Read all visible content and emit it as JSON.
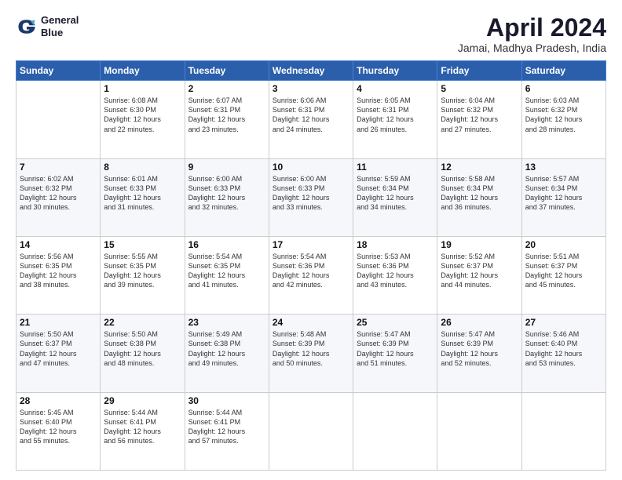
{
  "logo": {
    "line1": "General",
    "line2": "Blue"
  },
  "title": "April 2024",
  "subtitle": "Jamai, Madhya Pradesh, India",
  "days_of_week": [
    "Sunday",
    "Monday",
    "Tuesday",
    "Wednesday",
    "Thursday",
    "Friday",
    "Saturday"
  ],
  "weeks": [
    [
      {
        "day": "",
        "info": ""
      },
      {
        "day": "1",
        "info": "Sunrise: 6:08 AM\nSunset: 6:30 PM\nDaylight: 12 hours\nand 22 minutes."
      },
      {
        "day": "2",
        "info": "Sunrise: 6:07 AM\nSunset: 6:31 PM\nDaylight: 12 hours\nand 23 minutes."
      },
      {
        "day": "3",
        "info": "Sunrise: 6:06 AM\nSunset: 6:31 PM\nDaylight: 12 hours\nand 24 minutes."
      },
      {
        "day": "4",
        "info": "Sunrise: 6:05 AM\nSunset: 6:31 PM\nDaylight: 12 hours\nand 26 minutes."
      },
      {
        "day": "5",
        "info": "Sunrise: 6:04 AM\nSunset: 6:32 PM\nDaylight: 12 hours\nand 27 minutes."
      },
      {
        "day": "6",
        "info": "Sunrise: 6:03 AM\nSunset: 6:32 PM\nDaylight: 12 hours\nand 28 minutes."
      }
    ],
    [
      {
        "day": "7",
        "info": "Sunrise: 6:02 AM\nSunset: 6:32 PM\nDaylight: 12 hours\nand 30 minutes."
      },
      {
        "day": "8",
        "info": "Sunrise: 6:01 AM\nSunset: 6:33 PM\nDaylight: 12 hours\nand 31 minutes."
      },
      {
        "day": "9",
        "info": "Sunrise: 6:00 AM\nSunset: 6:33 PM\nDaylight: 12 hours\nand 32 minutes."
      },
      {
        "day": "10",
        "info": "Sunrise: 6:00 AM\nSunset: 6:33 PM\nDaylight: 12 hours\nand 33 minutes."
      },
      {
        "day": "11",
        "info": "Sunrise: 5:59 AM\nSunset: 6:34 PM\nDaylight: 12 hours\nand 34 minutes."
      },
      {
        "day": "12",
        "info": "Sunrise: 5:58 AM\nSunset: 6:34 PM\nDaylight: 12 hours\nand 36 minutes."
      },
      {
        "day": "13",
        "info": "Sunrise: 5:57 AM\nSunset: 6:34 PM\nDaylight: 12 hours\nand 37 minutes."
      }
    ],
    [
      {
        "day": "14",
        "info": "Sunrise: 5:56 AM\nSunset: 6:35 PM\nDaylight: 12 hours\nand 38 minutes."
      },
      {
        "day": "15",
        "info": "Sunrise: 5:55 AM\nSunset: 6:35 PM\nDaylight: 12 hours\nand 39 minutes."
      },
      {
        "day": "16",
        "info": "Sunrise: 5:54 AM\nSunset: 6:35 PM\nDaylight: 12 hours\nand 41 minutes."
      },
      {
        "day": "17",
        "info": "Sunrise: 5:54 AM\nSunset: 6:36 PM\nDaylight: 12 hours\nand 42 minutes."
      },
      {
        "day": "18",
        "info": "Sunrise: 5:53 AM\nSunset: 6:36 PM\nDaylight: 12 hours\nand 43 minutes."
      },
      {
        "day": "19",
        "info": "Sunrise: 5:52 AM\nSunset: 6:37 PM\nDaylight: 12 hours\nand 44 minutes."
      },
      {
        "day": "20",
        "info": "Sunrise: 5:51 AM\nSunset: 6:37 PM\nDaylight: 12 hours\nand 45 minutes."
      }
    ],
    [
      {
        "day": "21",
        "info": "Sunrise: 5:50 AM\nSunset: 6:37 PM\nDaylight: 12 hours\nand 47 minutes."
      },
      {
        "day": "22",
        "info": "Sunrise: 5:50 AM\nSunset: 6:38 PM\nDaylight: 12 hours\nand 48 minutes."
      },
      {
        "day": "23",
        "info": "Sunrise: 5:49 AM\nSunset: 6:38 PM\nDaylight: 12 hours\nand 49 minutes."
      },
      {
        "day": "24",
        "info": "Sunrise: 5:48 AM\nSunset: 6:39 PM\nDaylight: 12 hours\nand 50 minutes."
      },
      {
        "day": "25",
        "info": "Sunrise: 5:47 AM\nSunset: 6:39 PM\nDaylight: 12 hours\nand 51 minutes."
      },
      {
        "day": "26",
        "info": "Sunrise: 5:47 AM\nSunset: 6:39 PM\nDaylight: 12 hours\nand 52 minutes."
      },
      {
        "day": "27",
        "info": "Sunrise: 5:46 AM\nSunset: 6:40 PM\nDaylight: 12 hours\nand 53 minutes."
      }
    ],
    [
      {
        "day": "28",
        "info": "Sunrise: 5:45 AM\nSunset: 6:40 PM\nDaylight: 12 hours\nand 55 minutes."
      },
      {
        "day": "29",
        "info": "Sunrise: 5:44 AM\nSunset: 6:41 PM\nDaylight: 12 hours\nand 56 minutes."
      },
      {
        "day": "30",
        "info": "Sunrise: 5:44 AM\nSunset: 6:41 PM\nDaylight: 12 hours\nand 57 minutes."
      },
      {
        "day": "",
        "info": ""
      },
      {
        "day": "",
        "info": ""
      },
      {
        "day": "",
        "info": ""
      },
      {
        "day": "",
        "info": ""
      }
    ]
  ]
}
